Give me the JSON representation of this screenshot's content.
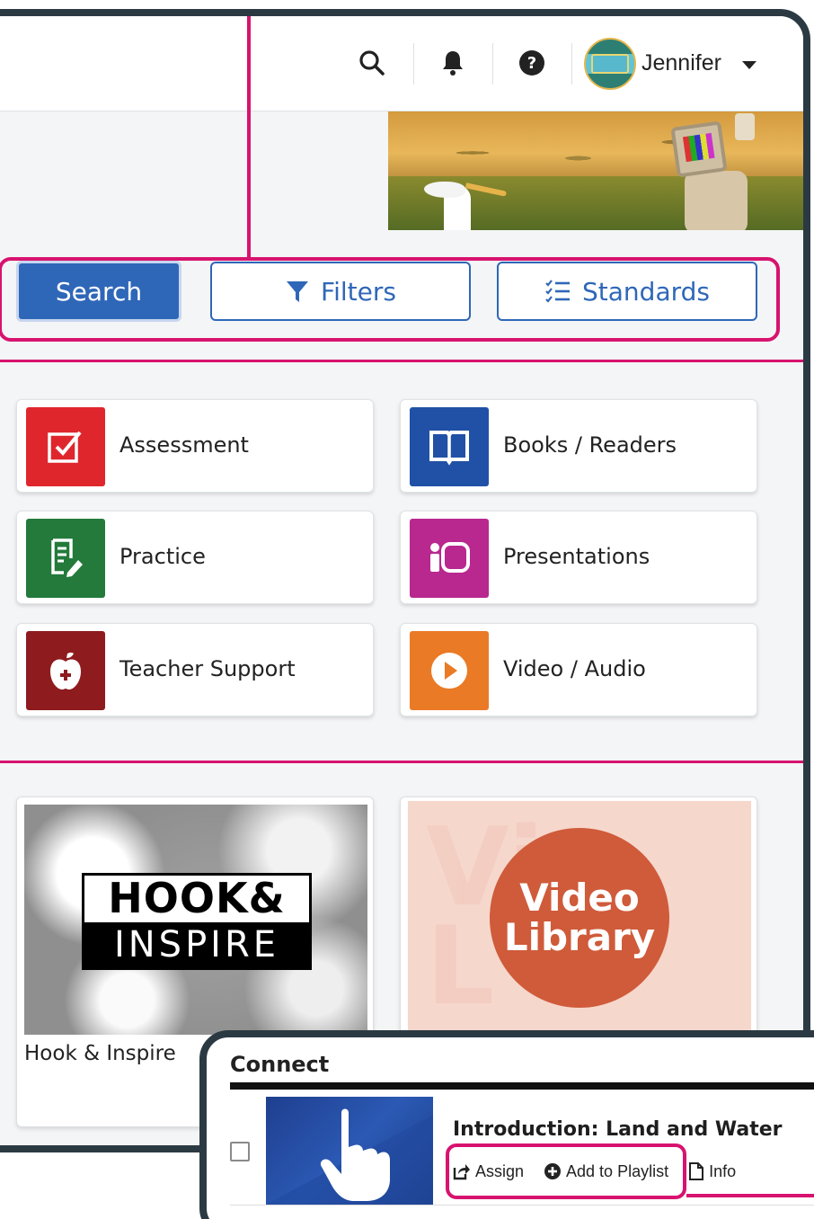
{
  "header": {
    "user_name": "Jennifer",
    "icons": [
      "search-icon",
      "bell-icon",
      "help-icon",
      "chevron-down-icon"
    ]
  },
  "search_bar": {
    "search_label": "Search",
    "filters_label": "Filters",
    "standards_label": "Standards"
  },
  "categories": [
    {
      "label": "Assessment",
      "icon": "checkbox-icon",
      "color": "#e0262d"
    },
    {
      "label": "Books / Readers",
      "icon": "book-icon",
      "color": "#2151a6"
    },
    {
      "label": "Practice",
      "icon": "edit-icon",
      "color": "#237a3b"
    },
    {
      "label": "Presentations",
      "icon": "presentation-icon",
      "color": "#b8288f"
    },
    {
      "label": "Teacher Support",
      "icon": "apple-icon",
      "color": "#8e1b1e"
    },
    {
      "label": "Video / Audio",
      "icon": "play-icon",
      "color": "#ea7a26"
    }
  ],
  "featured": [
    {
      "title": "Hook & Inspire",
      "logo_top": "HOOK&",
      "logo_bottom": "INSPIRE"
    },
    {
      "title": "",
      "logo_text_1": "Video",
      "logo_text_2": "Library"
    }
  ],
  "popup": {
    "section_title": "Connect",
    "item_title": "Introduction: Land and Water",
    "actions": {
      "assign": "Assign",
      "add_to_playlist": "Add to Playlist",
      "info": "Info"
    }
  },
  "colors": {
    "accent_blue": "#2f67b8",
    "callout_magenta": "#d7136f",
    "frame": "#2b3a42"
  }
}
